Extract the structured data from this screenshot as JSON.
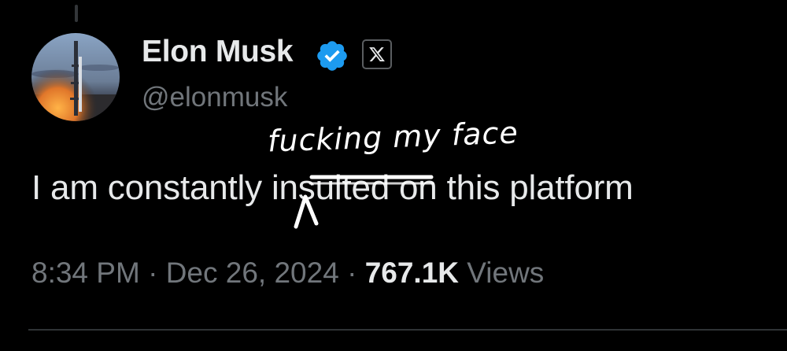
{
  "author": {
    "display_name": "Elon Musk",
    "handle": "@elonmusk",
    "avatar_icon": "rocket-launch-avatar",
    "verified_icon": "verified-badge-icon",
    "verified_color": "#1d9bf0",
    "affiliate_icon": "x-logo-icon"
  },
  "tweet": {
    "text_before": "I am constantly ",
    "struck_word": "insulted",
    "text_after": " on this platform"
  },
  "handwritten_annotation": {
    "text": "fucking my face",
    "color": "#ffffff"
  },
  "meta": {
    "time": "8:34 PM",
    "separator": " · ",
    "date": "Dec 26, 2024",
    "views_count": "767.1K",
    "views_label": " Views"
  },
  "colors": {
    "background": "#000000",
    "primary_text": "#e7e9ea",
    "secondary_text": "#71767b",
    "divider": "#2f3336"
  }
}
